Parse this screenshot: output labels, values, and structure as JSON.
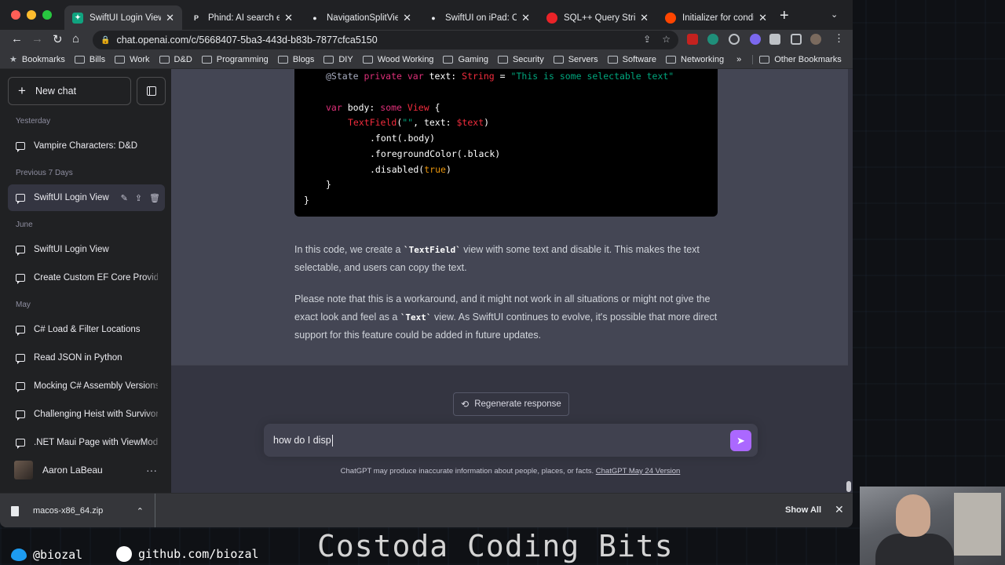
{
  "browser": {
    "tabs": [
      {
        "title": "SwiftUI Login View",
        "favicon": "chatgpt-icon",
        "color": "#10a37f",
        "active": true
      },
      {
        "title": "Phind: AI search engine",
        "favicon": "phind-icon",
        "color": "#202124"
      },
      {
        "title": "NavigationSplitView",
        "favicon": "apple-icon",
        "color": "#202124"
      },
      {
        "title": "SwiftUI on iPad: Organize",
        "favicon": "apple-icon",
        "color": "#202124"
      },
      {
        "title": "SQL++ Query Strings",
        "favicon": "couchbase-icon",
        "color": "#ea2328"
      },
      {
        "title": "Initializer for conditional",
        "favicon": "reddit-icon",
        "color": "#ff4500"
      }
    ],
    "url": "chat.openai.com/c/5668407-5ba3-443d-b83b-7877cfca5150",
    "bookmarks": [
      "Bookmarks",
      "Bills",
      "Work",
      "D&D",
      "Programming",
      "Blogs",
      "DIY",
      "Wood Working",
      "Gaming",
      "Security",
      "Servers",
      "Software",
      "Networking"
    ],
    "bookmarks_more": "»",
    "other_bookmarks": "Other Bookmarks"
  },
  "sidebar": {
    "new_chat": "New chat",
    "sections": [
      {
        "label": "Yesterday",
        "items": [
          {
            "label": "Vampire Characters: D&D"
          }
        ]
      },
      {
        "label": "Previous 7 Days",
        "items": [
          {
            "label": "SwiftUI Login View",
            "selected": true
          }
        ]
      },
      {
        "label": "June",
        "items": [
          {
            "label": "SwiftUI Login View"
          },
          {
            "label": "Create Custom EF Core Provider"
          }
        ]
      },
      {
        "label": "May",
        "items": [
          {
            "label": "C# Load & Filter Locations"
          },
          {
            "label": "Read JSON in Python"
          },
          {
            "label": "Mocking C# Assembly Versions"
          },
          {
            "label": "Challenging Heist with Survivors"
          },
          {
            "label": ".NET Maui Page with ViewModel"
          }
        ]
      }
    ],
    "user_name": "Aaron LaBeau"
  },
  "code": {
    "line1": {
      "attr": "@State",
      "kw": "private var",
      "name": "text:",
      "type": "String",
      "eq": "=",
      "str": "\"This is some selectable text\""
    },
    "line2": {
      "kw": "var",
      "name": "body:",
      "kw2": "some",
      "type": "View",
      "brace": "{"
    },
    "line3": {
      "type": "TextField",
      "args_open": "(",
      "str": "\"\"",
      "rest": ", text: ",
      "binding": "$text",
      "close": ")"
    },
    "line4": ".font(.body)",
    "line5": ".foregroundColor(.black)",
    "line6": {
      "pre": ".disabled(",
      "val": "true",
      "post": ")"
    },
    "line7": "}",
    "line8": "}"
  },
  "answer": {
    "p1_a": "In this code, we create a ",
    "p1_code": "`TextField`",
    "p1_b": " view with some text and disable it. This makes the text selectable, and users can copy the text.",
    "p2_a": "Please note that this is a workaround, and it might not work in all situations or might not give the exact look and feel as a ",
    "p2_code": "`Text`",
    "p2_b": " view. As SwiftUI continues to evolve, it's possible that more direct support for this feature could be added in future updates."
  },
  "regenerate": "Regenerate response",
  "composer_value": "how do I disp",
  "disclaimer": "ChatGPT may produce inaccurate information about people, places, or facts.",
  "disclaimer_link": "ChatGPT May 24 Version",
  "downloads": {
    "file": "macos-x86_64.zip",
    "show_all": "Show All"
  },
  "overlay": {
    "twitter": "@biozal",
    "github": "github.com/biozal",
    "brand": "Costoda Coding Bits"
  },
  "colors": {
    "accent_send": "#ab68ff",
    "chatgpt_green": "#10a37f"
  }
}
